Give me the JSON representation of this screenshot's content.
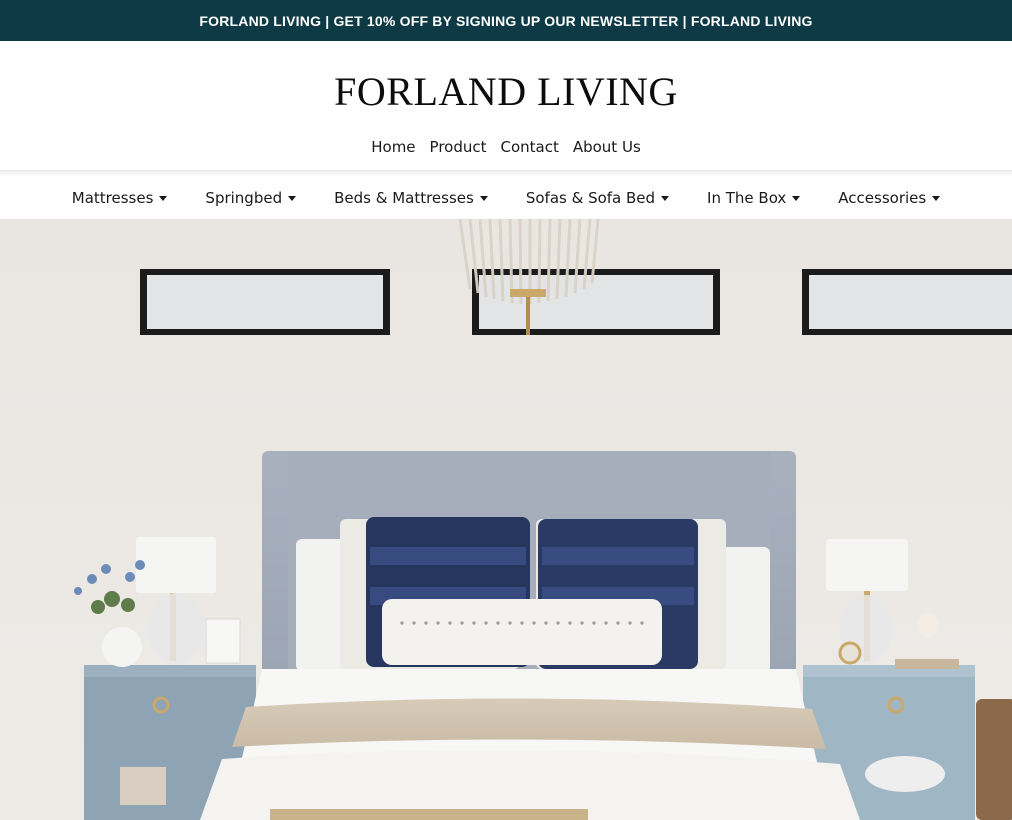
{
  "announcement": {
    "text": "FORLAND LIVING | GET 10% OFF BY SIGNING UP OUR NEWSLETTER | FORLAND LIVING"
  },
  "brand": {
    "logo_text": "FORLAND LIVING",
    "accent_color": "#0d3a44"
  },
  "top_nav": {
    "items": [
      {
        "label": "Home"
      },
      {
        "label": "Product"
      },
      {
        "label": "Contact"
      },
      {
        "label": "About Us"
      }
    ]
  },
  "category_nav": {
    "items": [
      {
        "label": "Mattresses",
        "icon": "caret-down-icon"
      },
      {
        "label": "Springbed",
        "icon": "caret-down-icon"
      },
      {
        "label": "Beds & Mattresses",
        "icon": "caret-down-icon"
      },
      {
        "label": "Sofas & Sofa Bed",
        "icon": "caret-down-icon"
      },
      {
        "label": "In The Box",
        "icon": "caret-down-icon"
      },
      {
        "label": "Accessories",
        "icon": "caret-down-icon"
      }
    ]
  },
  "hero": {
    "image": "bedroom-hero-image"
  }
}
